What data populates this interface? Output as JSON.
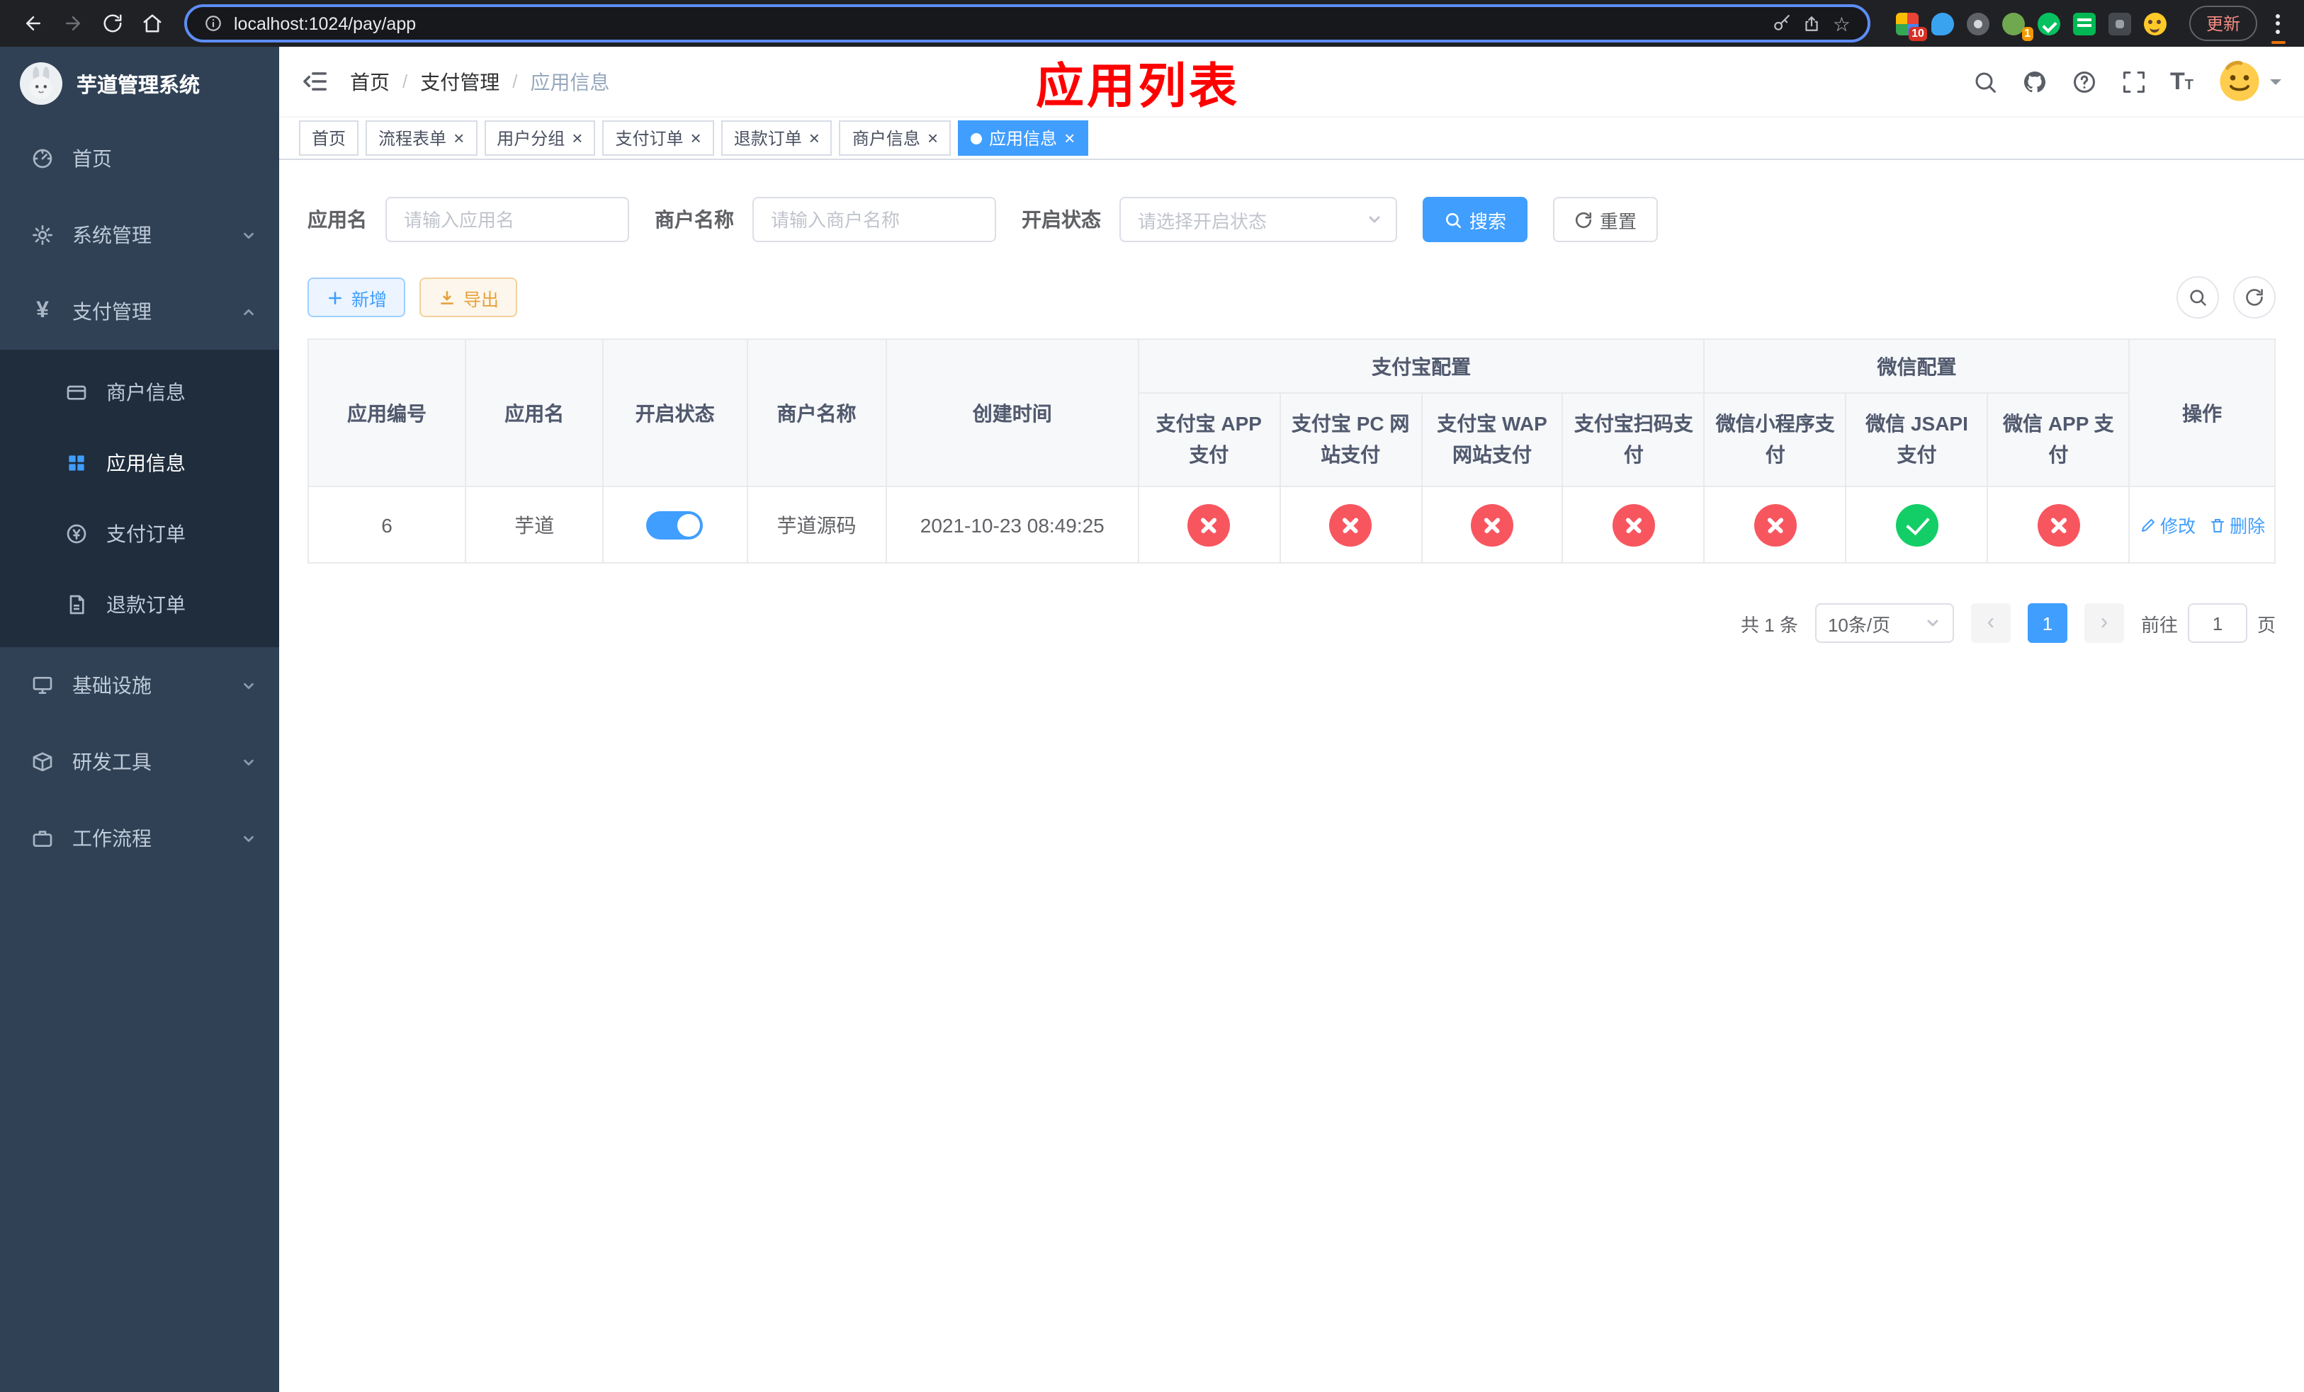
{
  "glyphs": {
    "close": "×",
    "separator": "/",
    "prev": "‹",
    "next": "›",
    "star": "☆",
    "letter_t": "T"
  },
  "browser": {
    "url": "localhost:1024/pay/app",
    "update_label": "更新",
    "extension_badge_grid": "10",
    "extension_badge_avatar": "1"
  },
  "sidebar": {
    "title": "芋道管理系统",
    "home": "首页",
    "system": "系统管理",
    "payment": "支付管理",
    "merchant_info": "商户信息",
    "app_info": "应用信息",
    "pay_order": "支付订单",
    "refund_order": "退款订单",
    "infrastructure": "基础设施",
    "dev_tools": "研发工具",
    "workflow": "工作流程"
  },
  "header": {
    "breadcrumb": [
      "首页",
      "支付管理",
      "应用信息"
    ],
    "annotation": "应用列表"
  },
  "tabs": [
    {
      "label": "首页"
    },
    {
      "label": "流程表单"
    },
    {
      "label": "用户分组"
    },
    {
      "label": "支付订单"
    },
    {
      "label": "退款订单"
    },
    {
      "label": "商户信息"
    },
    {
      "label": "应用信息"
    }
  ],
  "filters": {
    "app_name_label": "应用名",
    "app_name_placeholder": "请输入应用名",
    "merchant_label": "商户名称",
    "merchant_placeholder": "请输入商户名称",
    "status_label": "开启状态",
    "status_placeholder": "请选择开启状态",
    "search_label": "搜索",
    "reset_label": "重置"
  },
  "toolbar": {
    "add_label": "新增",
    "export_label": "导出"
  },
  "table": {
    "groups": {
      "alipay": "支付宝配置",
      "wechat": "微信配置"
    },
    "columns": {
      "id": "应用编号",
      "name": "应用名",
      "status": "开启状态",
      "merchant": "商户名称",
      "created": "创建时间",
      "actions": "操作",
      "channels": [
        "支付宝 APP 支付",
        "支付宝 PC 网站支付",
        "支付宝 WAP 网站支付",
        "支付宝扫码支付",
        "微信小程序支付",
        "微信 JSAPI 支付",
        "微信 APP 支付"
      ]
    },
    "row": {
      "id": "6",
      "name": "芋道",
      "status": "on",
      "merchant": "芋道源码",
      "created": "2021-10-23 08:49:25",
      "channels": [
        "disabled",
        "disabled",
        "disabled",
        "disabled",
        "disabled",
        "enabled",
        "disabled"
      ],
      "edit_label": "修改",
      "delete_label": "删除"
    }
  },
  "pagination": {
    "total": "共 1 条",
    "page_size": "10条/页",
    "page": "1",
    "goto_label": "前往",
    "goto_value": "1",
    "page_unit": "页"
  }
}
